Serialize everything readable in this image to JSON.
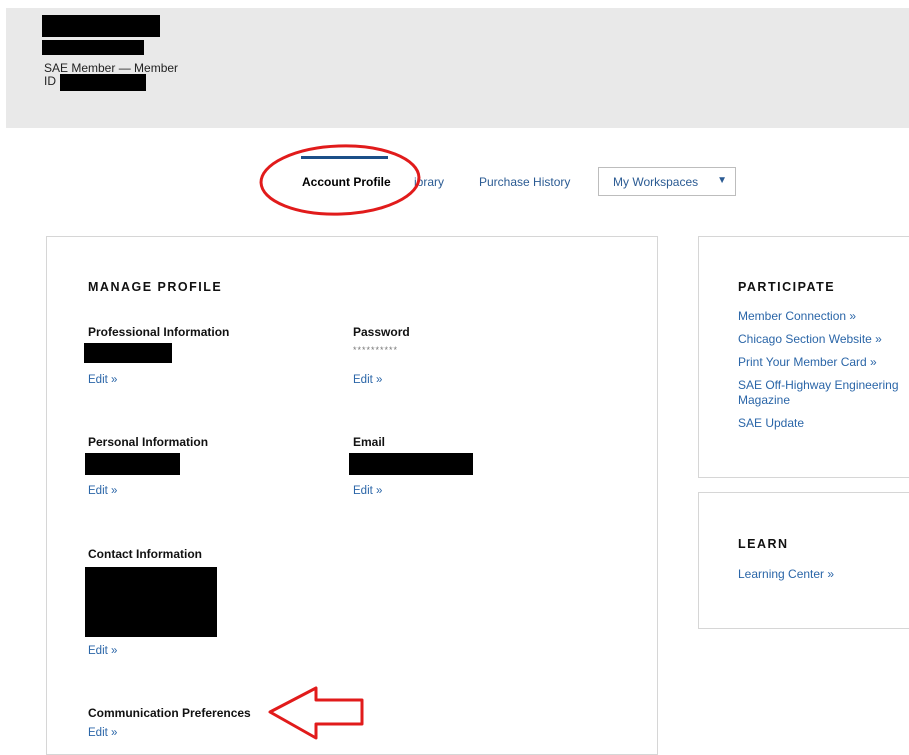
{
  "header": {
    "member_label": "SAE Member — Member",
    "id_label": "ID"
  },
  "tabs": {
    "items": [
      {
        "label": "Account Profile",
        "active": true
      },
      {
        "label": "Library",
        "visible_label": "ibrary"
      },
      {
        "label": "Purchase History"
      }
    ],
    "workspaces_select": {
      "value": "My Workspaces"
    }
  },
  "manage_profile": {
    "title": "MANAGE PROFILE",
    "professional_information": {
      "label": "Professional Information",
      "edit": "Edit »"
    },
    "password": {
      "label": "Password",
      "masked_value": "**********",
      "edit": "Edit »"
    },
    "personal_information": {
      "label": "Personal Information",
      "edit": "Edit »"
    },
    "email": {
      "label": "Email",
      "edit": "Edit »"
    },
    "contact_information": {
      "label": "Contact Information",
      "edit": "Edit »"
    },
    "communication_preferences": {
      "label": "Communication Preferences",
      "edit": "Edit »"
    }
  },
  "participate": {
    "title": "PARTICIPATE",
    "links": [
      "Member Connection »",
      "Chicago Section Website »",
      "Print Your Member Card »",
      "SAE Off-Highway Engineering",
      "Magazine",
      "SAE Update"
    ]
  },
  "learn": {
    "title": "LEARN",
    "links": [
      "Learning Center »"
    ]
  },
  "colors": {
    "accent_blue": "#2b66a8",
    "tab_underline": "#1b4f88",
    "annotation_red": "#e11b1b",
    "header_bg": "#e9e9e9"
  }
}
